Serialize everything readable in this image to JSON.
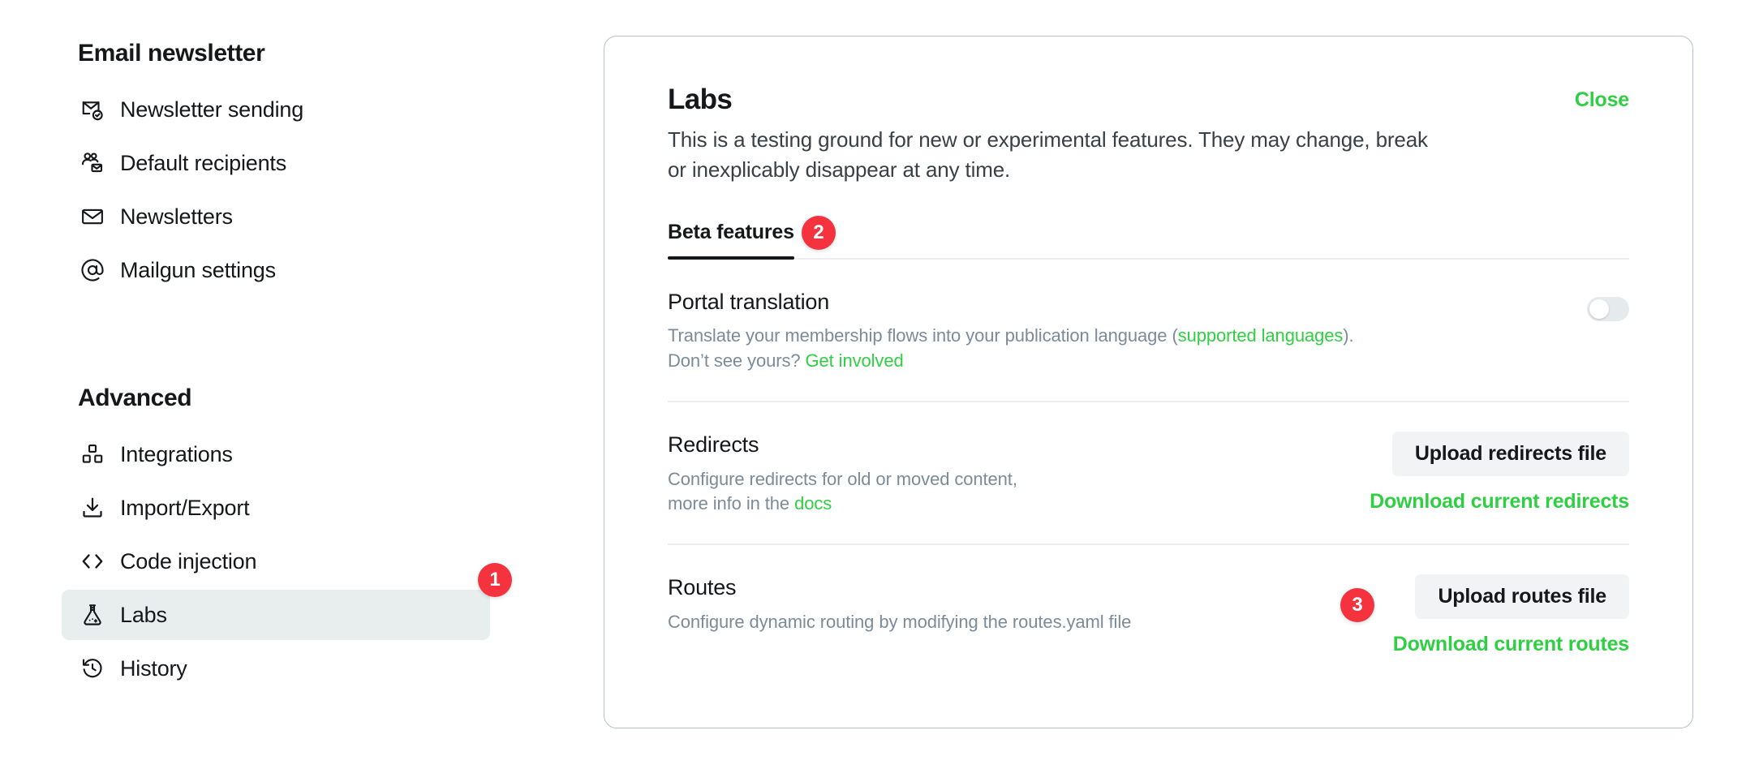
{
  "sidebar": {
    "groups": [
      {
        "title": "Email newsletter",
        "items": [
          {
            "label": "Newsletter sending",
            "icon": "mail-check-icon",
            "active": false
          },
          {
            "label": "Default recipients",
            "icon": "users-mail-icon",
            "active": false
          },
          {
            "label": "Newsletters",
            "icon": "envelope-icon",
            "active": false
          },
          {
            "label": "Mailgun settings",
            "icon": "at-sign-icon",
            "active": false
          }
        ]
      },
      {
        "title": "Advanced",
        "items": [
          {
            "label": "Integrations",
            "icon": "blocks-icon",
            "active": false
          },
          {
            "label": "Import/Export",
            "icon": "download-icon",
            "active": false
          },
          {
            "label": "Code injection",
            "icon": "code-brackets-icon",
            "active": false
          },
          {
            "label": "Labs",
            "icon": "flask-icon",
            "active": true
          },
          {
            "label": "History",
            "icon": "history-clock-icon",
            "active": false
          }
        ]
      }
    ]
  },
  "badges": [
    {
      "number": "1",
      "target": "sidebar-item-labs"
    },
    {
      "number": "2",
      "target": "tab-beta-features"
    },
    {
      "number": "3",
      "target": "upload-routes-file-button"
    }
  ],
  "panel": {
    "title": "Labs",
    "close_label": "Close",
    "description": "This is a testing ground for new or experimental features. They may change, break or inexplicably disappear at any time.",
    "tabs": [
      {
        "label": "Beta features",
        "active": true
      }
    ],
    "features": [
      {
        "title": "Portal translation",
        "desc_part1": "Translate your membership flows into your publication language (",
        "desc_link1": "supported languages",
        "desc_part2": ").",
        "desc_part3": "Don’t see yours? ",
        "desc_link2": "Get involved",
        "control": "toggle",
        "toggle_on": false
      },
      {
        "title": "Redirects",
        "desc_part1": "Configure redirects for old or moved content,",
        "desc_part2": "more info in the ",
        "desc_link1": "docs",
        "control": "buttons",
        "button_label": "Upload redirects file",
        "link_label": "Download current redirects"
      },
      {
        "title": "Routes",
        "desc_part1": "Configure dynamic routing by modifying the routes.yaml file",
        "control": "buttons",
        "button_label": "Upload routes file",
        "link_label": "Download current routes"
      }
    ]
  },
  "colors": {
    "accent_green": "#30cf43",
    "badge_red": "#f5333f",
    "active_nav_bg": "#e8edee",
    "text_primary": "#15171a",
    "text_muted": "#7c8b9a"
  }
}
